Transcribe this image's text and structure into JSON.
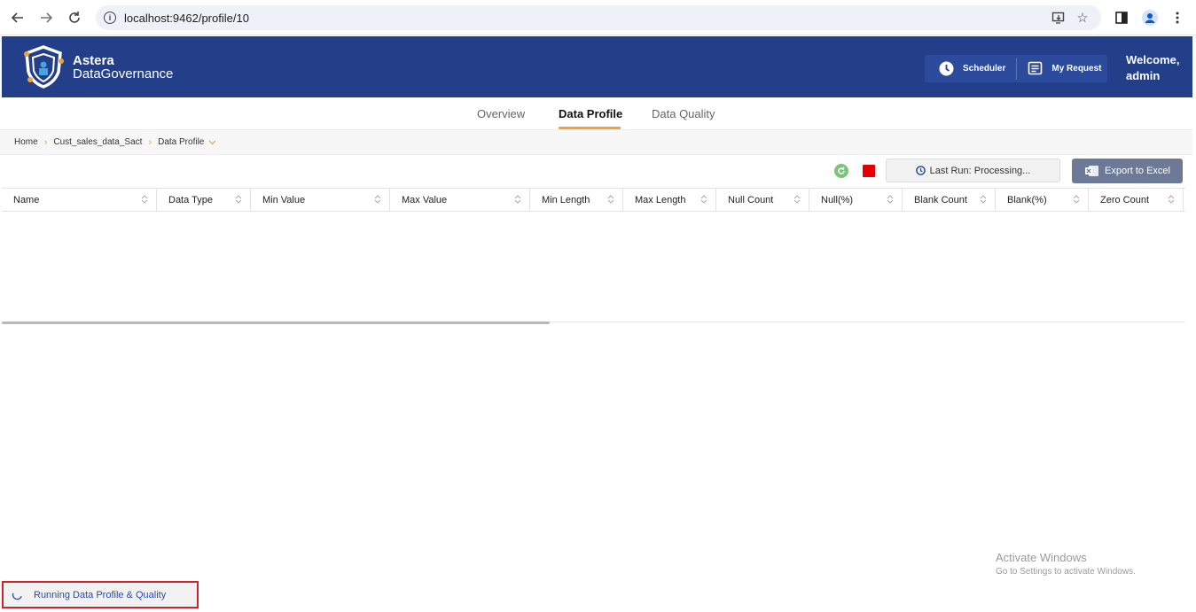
{
  "browser": {
    "url": "localhost:9462/profile/10"
  },
  "header": {
    "logo_line1": "Astera",
    "logo_line2": "DataGovernance",
    "scheduler_label": "Scheduler",
    "my_request_label": "My Request",
    "welcome_line1": "Welcome,",
    "welcome_line2": "admin"
  },
  "tabs": [
    {
      "label": "Overview",
      "active": false
    },
    {
      "label": "Data Profile",
      "active": true
    },
    {
      "label": "Data Quality",
      "active": false
    }
  ],
  "breadcrumb": {
    "items": [
      "Home",
      "Cust_sales_data_Sact",
      "Data Profile"
    ]
  },
  "toolbar": {
    "last_run_label": "Last Run: Processing...",
    "export_label": "Export to Excel"
  },
  "table": {
    "columns": [
      "Name",
      "Data Type",
      "Min Value",
      "Max Value",
      "Min Length",
      "Max Length",
      "Null Count",
      "Null(%)",
      "Blank Count",
      "Blank(%)",
      "Zero Count"
    ],
    "rows": []
  },
  "watermark": {
    "line1": "Activate Windows",
    "line2": "Go to Settings to activate Windows."
  },
  "status": {
    "text": "Running Data Profile & Quality"
  },
  "colors": {
    "header_bg": "#233f8a",
    "accent": "#f0a23a",
    "export_bg": "#6c7a97",
    "stop": "#e30000",
    "refresh": "#7cc47a",
    "status_border": "#d0242b"
  }
}
